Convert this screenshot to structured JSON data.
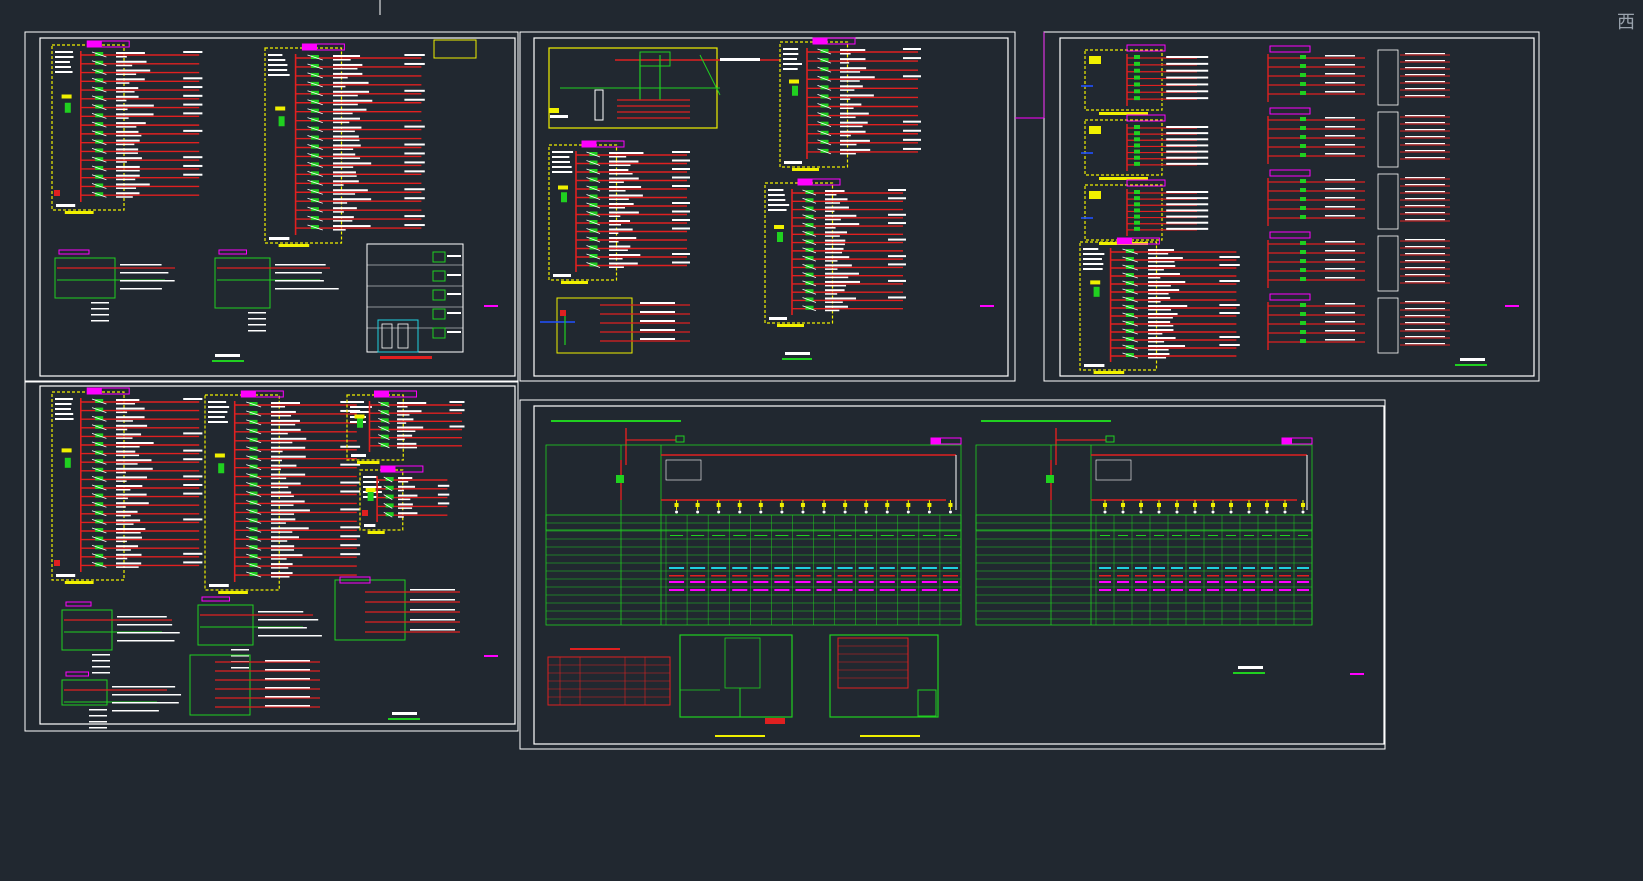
{
  "viewport": {
    "background": "#212830",
    "viewcube_label": "西"
  },
  "colors": {
    "frame": "#ffffff",
    "wire_red": "#e02020",
    "wire_green": "#20d020",
    "label_yellow": "#f0f000",
    "tag_magenta": "#ff00ff",
    "text_white": "#ffffff",
    "cyan": "#20d0e0",
    "blue": "#2050ff"
  },
  "sheets": [
    {
      "id": "sheet-1",
      "type": "distribution-panels"
    },
    {
      "id": "sheet-2",
      "type": "distribution-panels"
    },
    {
      "id": "sheet-3",
      "type": "distribution-panels"
    },
    {
      "id": "sheet-4",
      "type": "distribution-panels"
    },
    {
      "id": "sheet-5",
      "type": "system-table"
    }
  ]
}
